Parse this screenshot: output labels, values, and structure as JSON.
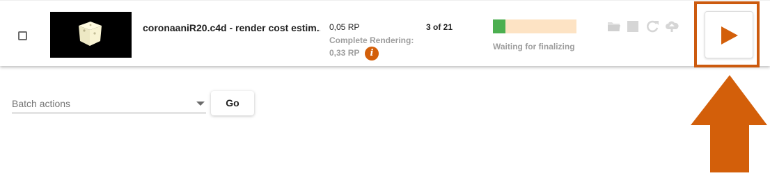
{
  "job": {
    "name": "coronaaniR20.c4d - render cost estim...",
    "cost": "0,05 RP",
    "complete_rendering_label": "Complete Rendering:",
    "complete_rendering_cost": "0,33 RP",
    "info_icon_text": "i",
    "frames": "3 of 21",
    "progress_fraction": 0.15,
    "status": "Waiting for finalizing"
  },
  "actions": {
    "icons": [
      "folder-icon",
      "stop-icon",
      "refresh-icon",
      "cloud-upload-icon",
      "play-icon"
    ]
  },
  "batch": {
    "label": "Batch actions",
    "go_label": "Go"
  },
  "colors": {
    "accent": "#d35f0a",
    "progress_fill": "#4caf50",
    "progress_track": "#fde3c4"
  }
}
